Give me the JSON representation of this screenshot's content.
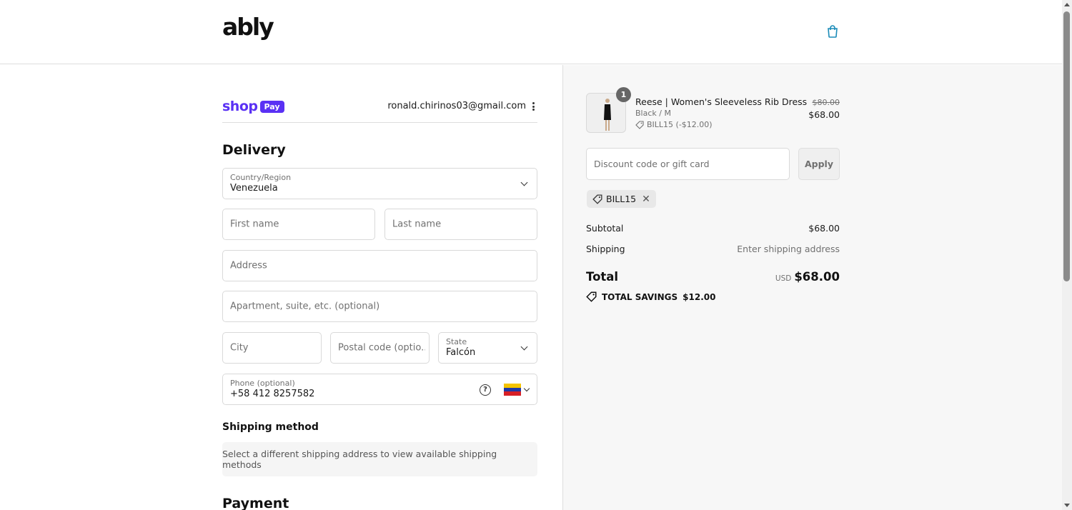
{
  "header": {
    "logo": "ably",
    "cart_icon": "shopping-bag-icon"
  },
  "account": {
    "shop_pay_word": "shop",
    "shop_pay_badge": "Pay",
    "email": "ronald.chirinos03@gmail.com",
    "menu_icon": "kebab-menu-icon"
  },
  "delivery": {
    "heading": "Delivery",
    "country": {
      "label": "Country/Region",
      "value": "Venezuela"
    },
    "first_name": {
      "placeholder": "First name"
    },
    "last_name": {
      "placeholder": "Last name"
    },
    "address": {
      "placeholder": "Address"
    },
    "apartment": {
      "placeholder": "Apartment, suite, etc. (optional)"
    },
    "city": {
      "placeholder": "City"
    },
    "postal_code": {
      "placeholder": "Postal code (optio..."
    },
    "state": {
      "label": "State",
      "value": "Falcón"
    },
    "phone": {
      "label": "Phone (optional)",
      "value": "+58 412 8257582",
      "help": "?",
      "flag": "venezuela-flag-icon"
    }
  },
  "shipping_method": {
    "heading": "Shipping method",
    "note": "Select a different shipping address to view available shipping methods"
  },
  "payment": {
    "heading": "Payment"
  },
  "summary": {
    "product": {
      "quantity": "1",
      "name": "Reese | Women's Sleeveless Rib Dress",
      "variant": "Black / M",
      "discount": "BILL15 (-$12.00)",
      "price_original": "$80.00",
      "price_current": "$68.00"
    },
    "discount_input": {
      "placeholder": "Discount code or gift card"
    },
    "apply_label": "Apply",
    "applied_code": "BILL15",
    "subtotal_label": "Subtotal",
    "subtotal_value": "$68.00",
    "shipping_label": "Shipping",
    "shipping_value": "Enter shipping address",
    "total_label": "Total",
    "total_currency": "USD",
    "total_value": "$68.00",
    "savings_label": "TOTAL SAVINGS",
    "savings_value": "$12.00"
  },
  "colors": {
    "shop_pay": "#5a31f4",
    "summary_bg": "#f7f7f7",
    "border": "#d9d9d9"
  }
}
